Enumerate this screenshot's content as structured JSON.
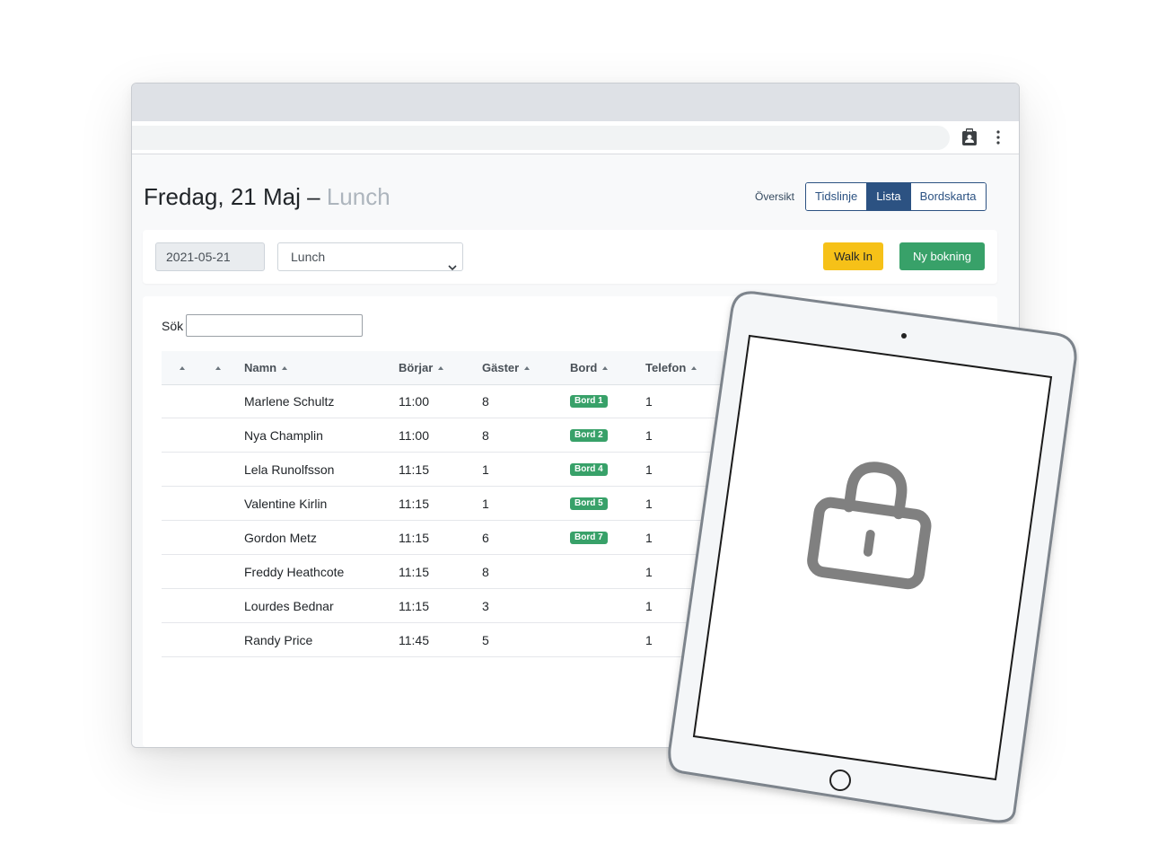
{
  "page": {
    "title_main": "Fredag, 21 Maj",
    "title_sep": "–",
    "title_meal": "Lunch"
  },
  "view_switch": {
    "overview_label": "Översikt",
    "segments": [
      {
        "label": "Tidslinje",
        "active": false
      },
      {
        "label": "Lista",
        "active": true
      },
      {
        "label": "Bordskarta",
        "active": false
      }
    ]
  },
  "filters": {
    "date_value": "2021-05-21",
    "meal_selected": "Lunch",
    "walk_in_label": "Walk In",
    "new_booking_label": "Ny bokning"
  },
  "table": {
    "search_label": "Sök",
    "search_value": "",
    "columns": [
      "",
      "",
      "Namn",
      "Börjar",
      "Gäster",
      "Bord",
      "Telefon"
    ],
    "rows": [
      {
        "name": "Marlene Schultz",
        "start": "11:00",
        "guests": "8",
        "table": "Bord 1",
        "phone": "1"
      },
      {
        "name": "Nya Champlin",
        "start": "11:00",
        "guests": "8",
        "table": "Bord 2",
        "phone": "1"
      },
      {
        "name": "Lela Runolfsson",
        "start": "11:15",
        "guests": "1",
        "table": "Bord 4",
        "phone": "1"
      },
      {
        "name": "Valentine Kirlin",
        "start": "11:15",
        "guests": "1",
        "table": "Bord 5",
        "phone": "1"
      },
      {
        "name": "Gordon Metz",
        "start": "11:15",
        "guests": "6",
        "table": "Bord 7",
        "phone": "1"
      },
      {
        "name": "Freddy Heathcote",
        "start": "11:15",
        "guests": "8",
        "table": "",
        "phone": "1"
      },
      {
        "name": "Lourdes Bednar",
        "start": "11:15",
        "guests": "3",
        "table": "",
        "phone": "1"
      },
      {
        "name": "Randy Price",
        "start": "11:45",
        "guests": "5",
        "table": "",
        "phone": "1"
      }
    ]
  },
  "icons": {
    "toolbar": [
      "clipboard-account-icon",
      "more-vert-icon"
    ],
    "device": "lock-icon"
  },
  "colors": {
    "primary": "#2c5282",
    "warning": "#f6c118",
    "success": "#38a169",
    "muted": "#adb5bd"
  }
}
